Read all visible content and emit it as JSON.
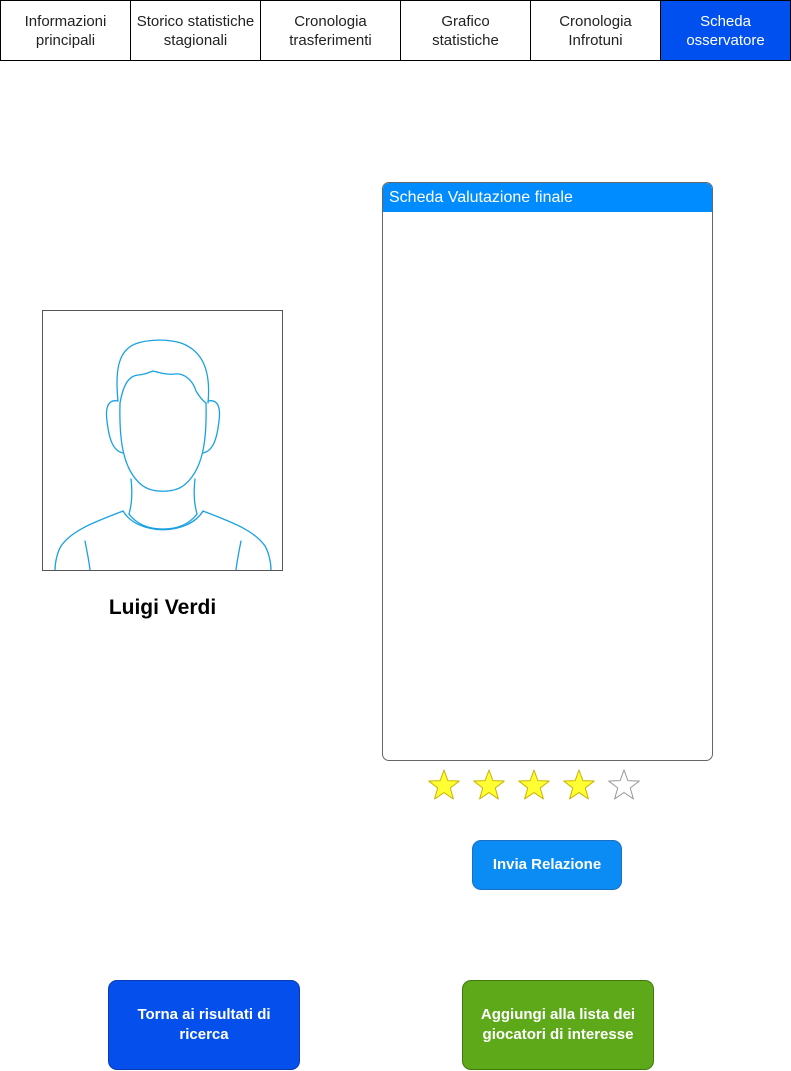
{
  "tabs": [
    {
      "label": "Informazioni\nprincipali",
      "active": false
    },
    {
      "label": "Storico statistiche\nstagionali",
      "active": false
    },
    {
      "label": "Cronologia\ntrasferimenti",
      "active": false
    },
    {
      "label": "Grafico\nstatistiche",
      "active": false
    },
    {
      "label": "Cronologia\nInfrotuni",
      "active": false
    },
    {
      "label": "Scheda\nosservatore",
      "active": true
    }
  ],
  "player": {
    "name": "Luigi Verdi"
  },
  "evaluation": {
    "title": "Scheda Valutazione finale",
    "text": "",
    "rating": 4,
    "max_rating": 5,
    "filled_color": "#ffff33",
    "empty_color": "#ffffff"
  },
  "buttons": {
    "send": "Invia Relazione",
    "back": "Torna ai risultati di\nricerca",
    "add": "Aggiungi alla lista dei\ngiocatori di interesse"
  },
  "colors": {
    "active_tab": "#0050ef",
    "panel_header": "#008cff",
    "send_button": "#0b8cf5",
    "back_button": "#0550ec",
    "add_button": "#5ea91a",
    "avatar_stroke": "#1ba1e2"
  }
}
